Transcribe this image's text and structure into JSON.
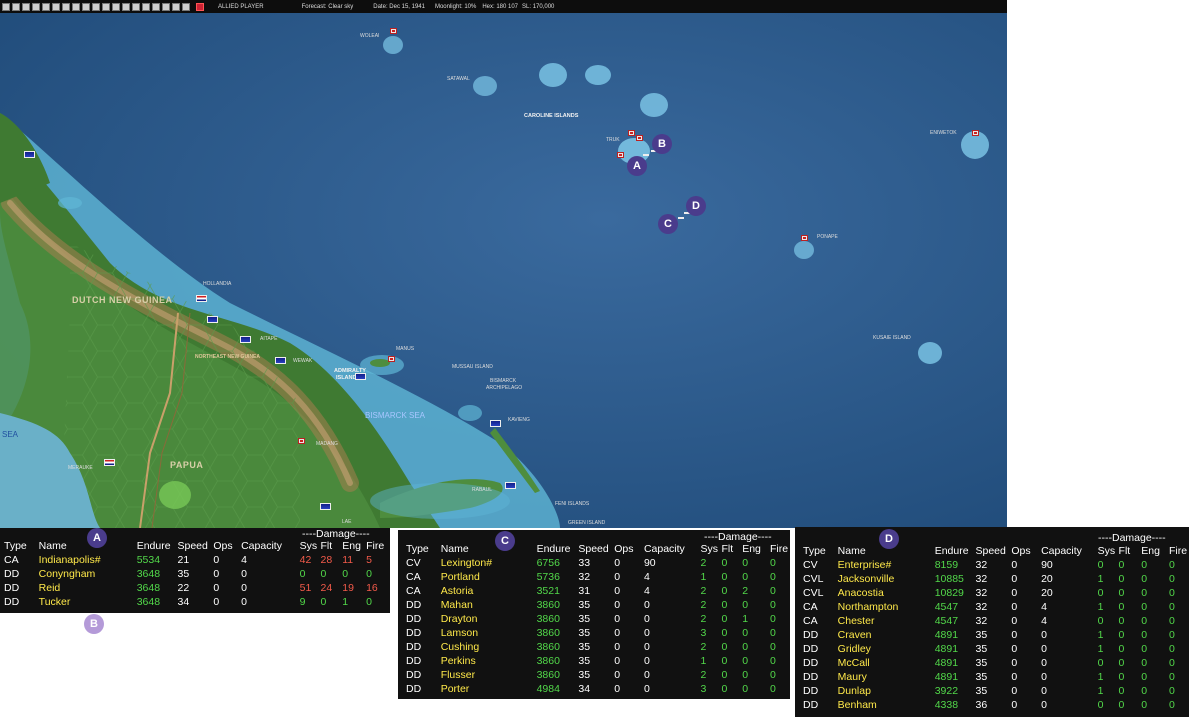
{
  "toolbar": {
    "player": "ALLIED PLAYER",
    "forecast": "Forecast: Clear sky",
    "date": "Date: Dec 15, 1941",
    "moonlight": "Moonlight: 10%",
    "hex": "Hex: 180 107",
    "sl": "SL: 170,000",
    "button_count": 20
  },
  "map": {
    "labels": {
      "woleai": "WOLEAI",
      "satawal": "SATAWAL",
      "caroline": "CAROLINE ISLANDS",
      "truk": "TRUK",
      "eniwetok": "ENIWETOK",
      "ponape": "PONAPE",
      "kusaie": "KUSAIE ISLAND",
      "hollandia": "HOLLANDIA",
      "dutch_new_guinea": "DUTCH NEW GUINEA",
      "aitape": "AITAPE",
      "wewak": "WEWAK",
      "manus": "MANUS",
      "admiralty": "ADMIRALTY",
      "admiralty2": "ISLANDS",
      "mussau": "MUSSAU ISLAND",
      "bismarck_arch": "BISMARCK",
      "bismarck_arch2": "ARCHIPELAGO",
      "northeast": "NORTHEAST NEW GUINEA",
      "bismarck_sea": "BISMARCK SEA",
      "kavieng": "KAVIENG",
      "madang": "MADANG",
      "sea": "SEA",
      "merauke": "MERAUKE",
      "papua": "PAPUA",
      "rabaul": "RABAUL",
      "feni": "FENI ISLANDS",
      "green": "GREEN ISLAND",
      "lae": "LAE"
    },
    "markers": {
      "a": "A",
      "b": "B",
      "c": "C",
      "d": "D",
      "b2": "B"
    }
  },
  "panel_a": {
    "marker": "A",
    "damage_header": "----Damage----",
    "headers": [
      "Type",
      "Name",
      "Endure",
      "Speed",
      "Ops",
      "Capacity",
      "Sys",
      "Flt",
      "Eng",
      "Fire"
    ],
    "rows": [
      {
        "type": "CA",
        "name": "Indianapolis#",
        "endure": "5534",
        "speed": "21",
        "ops": "0",
        "capacity": "4",
        "sys": "42",
        "flt": "28",
        "eng": "11",
        "fire": "5",
        "dcolor": "red"
      },
      {
        "type": "DD",
        "name": "Conyngham",
        "endure": "3648",
        "speed": "35",
        "ops": "0",
        "capacity": "0",
        "sys": "0",
        "flt": "0",
        "eng": "0",
        "fire": "0",
        "dcolor": "green"
      },
      {
        "type": "DD",
        "name": "Reid",
        "endure": "3648",
        "speed": "22",
        "ops": "0",
        "capacity": "0",
        "sys": "51",
        "flt": "24",
        "eng": "19",
        "fire": "16",
        "dcolor": "red"
      },
      {
        "type": "DD",
        "name": "Tucker",
        "endure": "3648",
        "speed": "34",
        "ops": "0",
        "capacity": "0",
        "sys": "9",
        "flt": "0",
        "eng": "1",
        "fire": "0",
        "dcolor": "green"
      }
    ]
  },
  "panel_c": {
    "marker": "C",
    "damage_header": "----Damage----",
    "headers": [
      "Type",
      "Name",
      "Endure",
      "Speed",
      "Ops",
      "Capacity",
      "Sys",
      "Flt",
      "Eng",
      "Fire"
    ],
    "rows": [
      {
        "type": "CV",
        "name": "Lexington#",
        "endure": "6756",
        "speed": "33",
        "ops": "0",
        "capacity": "90",
        "sys": "2",
        "flt": "0",
        "eng": "0",
        "fire": "0"
      },
      {
        "type": "CA",
        "name": "Portland",
        "endure": "5736",
        "speed": "32",
        "ops": "0",
        "capacity": "4",
        "sys": "1",
        "flt": "0",
        "eng": "0",
        "fire": "0"
      },
      {
        "type": "CA",
        "name": "Astoria",
        "endure": "3521",
        "speed": "31",
        "ops": "0",
        "capacity": "4",
        "sys": "2",
        "flt": "0",
        "eng": "2",
        "fire": "0"
      },
      {
        "type": "DD",
        "name": "Mahan",
        "endure": "3860",
        "speed": "35",
        "ops": "0",
        "capacity": "0",
        "sys": "2",
        "flt": "0",
        "eng": "0",
        "fire": "0"
      },
      {
        "type": "DD",
        "name": "Drayton",
        "endure": "3860",
        "speed": "35",
        "ops": "0",
        "capacity": "0",
        "sys": "2",
        "flt": "0",
        "eng": "1",
        "fire": "0"
      },
      {
        "type": "DD",
        "name": "Lamson",
        "endure": "3860",
        "speed": "35",
        "ops": "0",
        "capacity": "0",
        "sys": "3",
        "flt": "0",
        "eng": "0",
        "fire": "0"
      },
      {
        "type": "DD",
        "name": "Cushing",
        "endure": "3860",
        "speed": "35",
        "ops": "0",
        "capacity": "0",
        "sys": "2",
        "flt": "0",
        "eng": "0",
        "fire": "0"
      },
      {
        "type": "DD",
        "name": "Perkins",
        "endure": "3860",
        "speed": "35",
        "ops": "0",
        "capacity": "0",
        "sys": "1",
        "flt": "0",
        "eng": "0",
        "fire": "0"
      },
      {
        "type": "DD",
        "name": "Flusser",
        "endure": "3860",
        "speed": "35",
        "ops": "0",
        "capacity": "0",
        "sys": "2",
        "flt": "0",
        "eng": "0",
        "fire": "0"
      },
      {
        "type": "DD",
        "name": "Porter",
        "endure": "4984",
        "speed": "34",
        "ops": "0",
        "capacity": "0",
        "sys": "3",
        "flt": "0",
        "eng": "0",
        "fire": "0"
      }
    ]
  },
  "panel_d": {
    "marker": "D",
    "damage_header": "----Damage----",
    "headers": [
      "Type",
      "Name",
      "Endure",
      "Speed",
      "Ops",
      "Capacity",
      "Sys",
      "Flt",
      "Eng",
      "Fire"
    ],
    "rows": [
      {
        "type": "CV",
        "name": "Enterprise#",
        "endure": "8159",
        "speed": "32",
        "ops": "0",
        "capacity": "90",
        "sys": "0",
        "flt": "0",
        "eng": "0",
        "fire": "0"
      },
      {
        "type": "CVL",
        "name": "Jacksonville",
        "endure": "10885",
        "speed": "32",
        "ops": "0",
        "capacity": "20",
        "sys": "1",
        "flt": "0",
        "eng": "0",
        "fire": "0"
      },
      {
        "type": "CVL",
        "name": "Anacostia",
        "endure": "10829",
        "speed": "32",
        "ops": "0",
        "capacity": "20",
        "sys": "0",
        "flt": "0",
        "eng": "0",
        "fire": "0"
      },
      {
        "type": "CA",
        "name": "Northampton",
        "endure": "4547",
        "speed": "32",
        "ops": "0",
        "capacity": "4",
        "sys": "1",
        "flt": "0",
        "eng": "0",
        "fire": "0"
      },
      {
        "type": "CA",
        "name": "Chester",
        "endure": "4547",
        "speed": "32",
        "ops": "0",
        "capacity": "4",
        "sys": "0",
        "flt": "0",
        "eng": "0",
        "fire": "0"
      },
      {
        "type": "DD",
        "name": "Craven",
        "endure": "4891",
        "speed": "35",
        "ops": "0",
        "capacity": "0",
        "sys": "1",
        "flt": "0",
        "eng": "0",
        "fire": "0"
      },
      {
        "type": "DD",
        "name": "Gridley",
        "endure": "4891",
        "speed": "35",
        "ops": "0",
        "capacity": "0",
        "sys": "1",
        "flt": "0",
        "eng": "0",
        "fire": "0"
      },
      {
        "type": "DD",
        "name": "McCall",
        "endure": "4891",
        "speed": "35",
        "ops": "0",
        "capacity": "0",
        "sys": "0",
        "flt": "0",
        "eng": "0",
        "fire": "0"
      },
      {
        "type": "DD",
        "name": "Maury",
        "endure": "4891",
        "speed": "35",
        "ops": "0",
        "capacity": "0",
        "sys": "1",
        "flt": "0",
        "eng": "0",
        "fire": "0"
      },
      {
        "type": "DD",
        "name": "Dunlap",
        "endure": "3922",
        "speed": "35",
        "ops": "0",
        "capacity": "0",
        "sys": "1",
        "flt": "0",
        "eng": "0",
        "fire": "0"
      },
      {
        "type": "DD",
        "name": "Benham",
        "endure": "4338",
        "speed": "36",
        "ops": "0",
        "capacity": "0",
        "sys": "0",
        "flt": "0",
        "eng": "0",
        "fire": "0"
      }
    ]
  }
}
